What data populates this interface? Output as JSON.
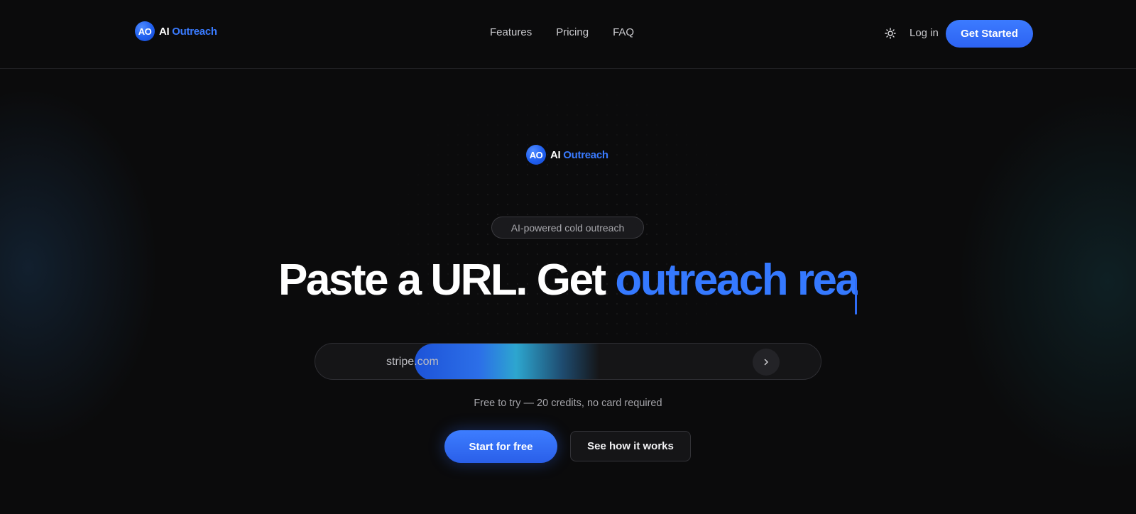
{
  "brand": {
    "mark": "AO",
    "name_part1": "AI",
    "name_part2": "Outreach"
  },
  "nav": {
    "links": [
      "Features",
      "Pricing",
      "FAQ"
    ],
    "theme_icon": "sun-icon",
    "login_label": "Log in",
    "cta_label": "Get Started"
  },
  "hero": {
    "badge": "AI-powered cold outreach",
    "headline_white": "Paste a URL. Get ",
    "headline_blue": "outreach rea",
    "search": {
      "placeholder": "stripe.com",
      "submit_icon": "chevron-right-icon"
    },
    "note": "Free to try — 20 credits, no card required",
    "primary_label": "Start for free",
    "secondary_label": "See how it works"
  },
  "colors": {
    "accent": "#3579ff",
    "background": "#0b0b0c"
  }
}
